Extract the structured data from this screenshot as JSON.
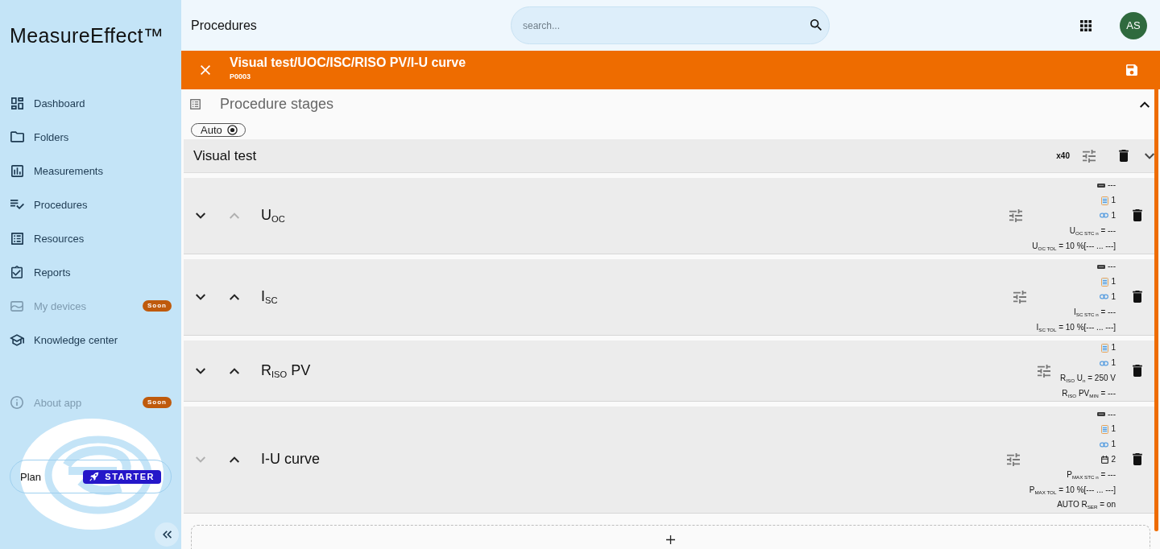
{
  "sidebar": {
    "logo": "MeasureEffect™",
    "items": [
      {
        "label": "Dashboard",
        "disabled": false
      },
      {
        "label": "Folders",
        "disabled": false
      },
      {
        "label": "Measurements",
        "disabled": false
      },
      {
        "label": "Procedures",
        "disabled": false
      },
      {
        "label": "Resources",
        "disabled": false
      },
      {
        "label": "Reports",
        "disabled": false
      },
      {
        "label": "My devices",
        "disabled": true,
        "badge": "Soon"
      },
      {
        "label": "Knowledge center",
        "disabled": false
      }
    ],
    "footer_items": [
      {
        "label": "About app",
        "disabled": true,
        "badge": "Soon"
      }
    ],
    "plan": {
      "label": "Plan",
      "badge": "STARTER"
    }
  },
  "header": {
    "title": "Procedures",
    "search": {
      "placeholder": "search..."
    },
    "avatar": "AS"
  },
  "procedure": {
    "title": "Visual test/UOC/ISC/RISO PV/I-U curve",
    "code": "P0003",
    "stages_heading": "Procedure stages",
    "expanded": true,
    "mode_chip": {
      "label": "Auto",
      "selected": true
    },
    "first_stage": {
      "title": "Visual test",
      "repeat": "x40",
      "expanded": false
    },
    "stages": [
      {
        "title": "U$_{OC}$",
        "down_disabled": false,
        "up_disabled": true,
        "details": [
          {
            "kind": "device",
            "text": "---"
          },
          {
            "kind": "sheet",
            "text": "1"
          },
          {
            "kind": "link",
            "text": "1"
          },
          {
            "kind": "param",
            "text": "U$_{OC STC n}$ = ---"
          },
          {
            "kind": "param",
            "text": "U$_{OC TOL}$ = 10 %[--- ... ---]"
          }
        ]
      },
      {
        "title": "I$_{SC}$",
        "down_disabled": false,
        "up_disabled": false,
        "details": [
          {
            "kind": "device",
            "text": "---"
          },
          {
            "kind": "sheet",
            "text": "1"
          },
          {
            "kind": "link",
            "text": "1"
          },
          {
            "kind": "param",
            "text": "I$_{SC STC n}$ = ---"
          },
          {
            "kind": "param",
            "text": "I$_{SC TOL}$ = 10 %[--- ... ---]"
          }
        ]
      },
      {
        "title": "R$_{ISO}$ PV",
        "down_disabled": false,
        "up_disabled": false,
        "details": [
          {
            "kind": "sheet",
            "text": "1"
          },
          {
            "kind": "link",
            "text": "1"
          },
          {
            "kind": "param",
            "text": "R$_{ISO}$ U$_{n}$ = 250 V"
          },
          {
            "kind": "param",
            "text": "R$_{ISO}$ PV$_{MIN}$ = ---"
          }
        ]
      },
      {
        "title": "I-U curve",
        "down_disabled": true,
        "up_disabled": false,
        "details": [
          {
            "kind": "device",
            "text": "---"
          },
          {
            "kind": "sheet",
            "text": "1"
          },
          {
            "kind": "link",
            "text": "1"
          },
          {
            "kind": "calendar",
            "text": "2"
          },
          {
            "kind": "param",
            "text": "P$_{MAX STC n}$ = ---"
          },
          {
            "kind": "param",
            "text": "P$_{MAX TOL}$ = 10 %[--- ... ---]"
          },
          {
            "kind": "param",
            "text": "AUTO R$_{SER}$ = on"
          }
        ]
      }
    ]
  }
}
